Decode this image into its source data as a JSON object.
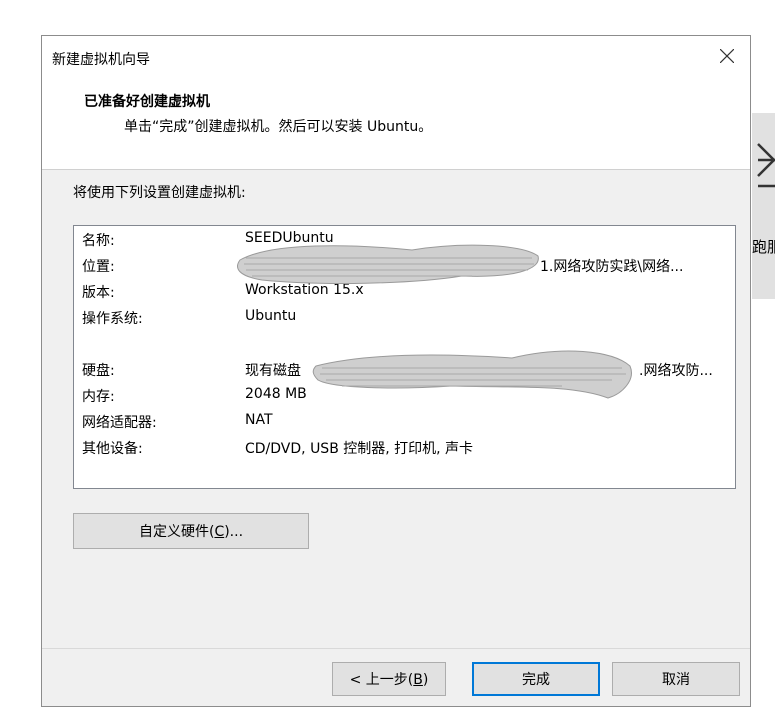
{
  "background_app": {
    "text_fragment": "跑服"
  },
  "dialog": {
    "title": "新建虚拟机向导",
    "header_title": "已准备好创建虚拟机",
    "header_subtitle": "单击“完成”创建虚拟机。然后可以安装 Ubuntu。",
    "intro": "将使用下列设置创建虚拟机:",
    "summary": [
      {
        "key": "名称:",
        "value": "SEEDUbuntu"
      },
      {
        "key": "位置:",
        "value": "1.网络攻防实践\\网络..."
      },
      {
        "key": "版本:",
        "value": "Workstation 15.x"
      },
      {
        "key": "操作系统:",
        "value": "Ubuntu"
      },
      {
        "key": "硬盘:",
        "value": "现有磁盘",
        "value_tail": ".网络攻防..."
      },
      {
        "key": "内存:",
        "value": "2048 MB"
      },
      {
        "key": "网络适配器:",
        "value": "NAT"
      },
      {
        "key": "其他设备:",
        "value": "CD/DVD, USB 控制器, 打印机, 声卡"
      }
    ],
    "customize_button": {
      "label": "自定义硬件(",
      "mnemonic": "C",
      "suffix": ")..."
    },
    "back_button": {
      "label": "< 上一步(",
      "mnemonic": "B",
      "suffix": ")"
    },
    "finish_button": "完成",
    "cancel_button": "取消"
  },
  "colors": {
    "dialog_bg": "#f0f0f0",
    "accent_focus": "#0078d7",
    "button_bg": "#e1e1e1"
  }
}
